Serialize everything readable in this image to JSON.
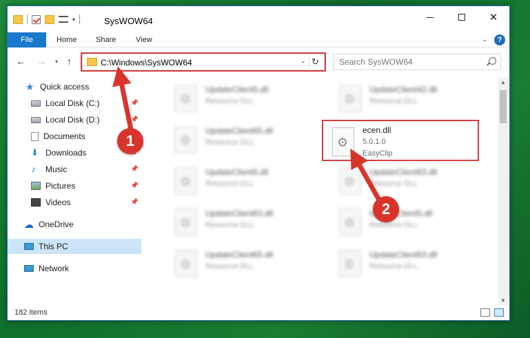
{
  "window": {
    "title": "SysWOW64",
    "controls": {
      "minimize": "minimize",
      "maximize": "maximize",
      "close": "✕"
    }
  },
  "ribbon": {
    "tabs": [
      "File",
      "Home",
      "Share",
      "View"
    ],
    "help": "?"
  },
  "address": {
    "path": "C:\\Windows\\SysWOW64",
    "search_placeholder": "Search SysWOW64"
  },
  "sidebar": {
    "items": [
      {
        "label": "Quick access",
        "icon": "star-icon"
      },
      {
        "label": "Local Disk (C:)",
        "icon": "disk-icon",
        "pinned": true
      },
      {
        "label": "Local Disk (D:)",
        "icon": "disk-icon",
        "pinned": true
      },
      {
        "label": "Documents",
        "icon": "document-icon",
        "pinned": true
      },
      {
        "label": "Downloads",
        "icon": "download-icon",
        "pinned": true
      },
      {
        "label": "Music",
        "icon": "music-icon",
        "pinned": true
      },
      {
        "label": "Pictures",
        "icon": "pictures-icon",
        "pinned": true
      },
      {
        "label": "Videos",
        "icon": "video-icon",
        "pinned": true
      },
      {
        "label": "OneDrive",
        "icon": "onedrive-icon"
      },
      {
        "label": "This PC",
        "icon": "pc-icon",
        "selected": true
      },
      {
        "label": "Network",
        "icon": "network-icon"
      }
    ]
  },
  "files": {
    "left_column": [
      {
        "name": "UpdateClient5.dll",
        "desc": "Resource DLL"
      },
      {
        "name": "UpdateClient65.dll",
        "desc": "Resource DLL"
      },
      {
        "name": "UpdateClient5.dll",
        "desc": "Resource DLL"
      },
      {
        "name": "UpdateClient63.dll",
        "desc": "Resource DLL"
      },
      {
        "name": "UpdateClient65.dll",
        "desc": "Resource DLL"
      }
    ],
    "right_column": [
      {
        "name": "UpdateClient42.dll",
        "desc": "Resource DLL"
      },
      {
        "name": "UpdateClient63.dll",
        "desc": "Resource DLL"
      },
      {
        "name": "UpdateClient5.dll",
        "desc": "Resource DLL"
      },
      {
        "name": "UpdateClient63.dll",
        "desc": "Resource DLL"
      }
    ],
    "highlighted": {
      "name": "ecen.dll",
      "version": "5.0.1.0",
      "company": "EasyClip"
    }
  },
  "status": {
    "items_count": "182 items"
  },
  "annotations": {
    "step1": "1",
    "step2": "2",
    "color": "#d9342b"
  }
}
